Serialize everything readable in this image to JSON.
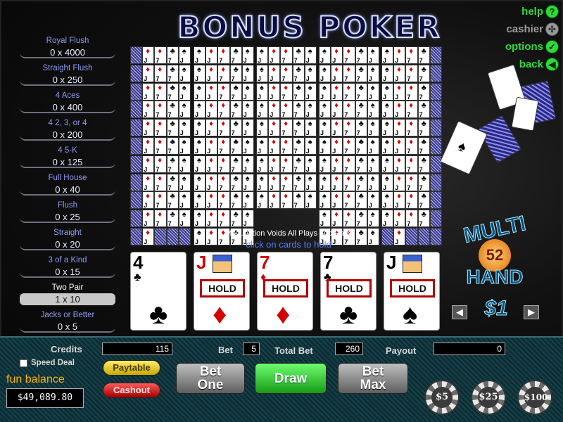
{
  "title": "BONUS POKER",
  "nav": [
    {
      "label": "help",
      "icon": "?",
      "enabled": true
    },
    {
      "label": "cashier",
      "icon": "✣",
      "enabled": false
    },
    {
      "label": "options",
      "icon": "✓",
      "enabled": true
    },
    {
      "label": "back",
      "icon": "◀",
      "enabled": true
    }
  ],
  "paytable": [
    {
      "name": "Royal Flush",
      "value": "0 x 4000"
    },
    {
      "name": "Straight Flush",
      "value": "0 x 250"
    },
    {
      "name": "4 Aces",
      "value": "0 x 400"
    },
    {
      "name": "4 2, 3, or 4",
      "value": "0 x 200"
    },
    {
      "name": "4 5-K",
      "value": "0 x 125"
    },
    {
      "name": "Full House",
      "value": "0 x 40"
    },
    {
      "name": "Flush",
      "value": "0 x 25"
    },
    {
      "name": "Straight",
      "value": "0 x 20"
    },
    {
      "name": "3 of a Kind",
      "value": "0 x 15"
    },
    {
      "name": "Two Pair",
      "value": "1 x 10",
      "active": true
    },
    {
      "name": "Jacks or Better",
      "value": "0 x 5"
    }
  ],
  "mini_hand_pattern": [
    {
      "rank": "J",
      "suit": "♠",
      "color": "black"
    },
    {
      "rank": "J",
      "suit": "♦",
      "color": "red"
    },
    {
      "rank": "7",
      "suit": "♦",
      "color": "red"
    },
    {
      "rank": "7",
      "suit": "♣",
      "color": "black"
    },
    {
      "rank": "J",
      "suit": "♠",
      "color": "black"
    }
  ],
  "notice": "Malfunction Voids All Plays and Pays",
  "hold_hint": "click on cards to hold",
  "hand": [
    {
      "rank": "4",
      "suit": "♣",
      "color": "black",
      "held": false,
      "face": false
    },
    {
      "rank": "J",
      "suit": "♦",
      "color": "red",
      "held": true,
      "face": true
    },
    {
      "rank": "7",
      "suit": "♦",
      "color": "red",
      "held": true,
      "face": false
    },
    {
      "rank": "7",
      "suit": "♣",
      "color": "black",
      "held": true,
      "face": false
    },
    {
      "rank": "J",
      "suit": "♠",
      "color": "black",
      "held": true,
      "face": true
    }
  ],
  "hold_label": "HOLD",
  "logo": {
    "top": "MULTI",
    "count": "52",
    "bottom": "HAND",
    "denomination": "$1"
  },
  "credits_label": "Credits",
  "credits": "115",
  "bet_label": "Bet",
  "bet": "5",
  "total_bet_label": "Total Bet",
  "total_bet": "260",
  "payout_label": "Payout",
  "payout": "0",
  "speed_deal_label": "Speed Deal",
  "paytable_button": "Paytable",
  "cashout_button": "Cashout",
  "fun_balance_label": "fun balance",
  "fun_balance": "$49,089.80",
  "buttons": {
    "bet_one": "Bet One",
    "draw": "Draw",
    "bet_max": "Bet Max"
  },
  "chips": [
    "$5",
    "$25",
    "$100"
  ],
  "colors": {
    "accent_green": "#2fd83a",
    "paytable_blue": "#8c9cf0",
    "hold_red": "#b00000"
  }
}
